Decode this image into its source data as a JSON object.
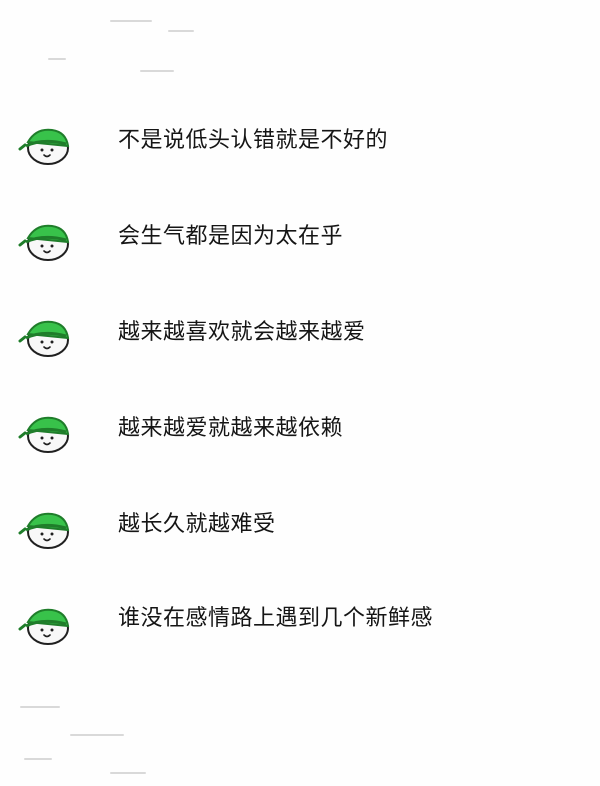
{
  "lines": [
    {
      "text": "不是说低头认错就是不好的"
    },
    {
      "text": "会生气都是因为太在乎"
    },
    {
      "text": "越来越喜欢就会越来越爱"
    },
    {
      "text": "越来越爱就越来越依赖"
    },
    {
      "text": "越长久就越难受"
    },
    {
      "text": "谁没在感情路上遇到几个新鲜感"
    }
  ],
  "icons": {
    "avatar": "green-cap-face-icon"
  },
  "colors": {
    "cap_green": "#38c24a",
    "cap_dark": "#1f7d2a",
    "text": "#151515",
    "background": "#fefefe"
  }
}
